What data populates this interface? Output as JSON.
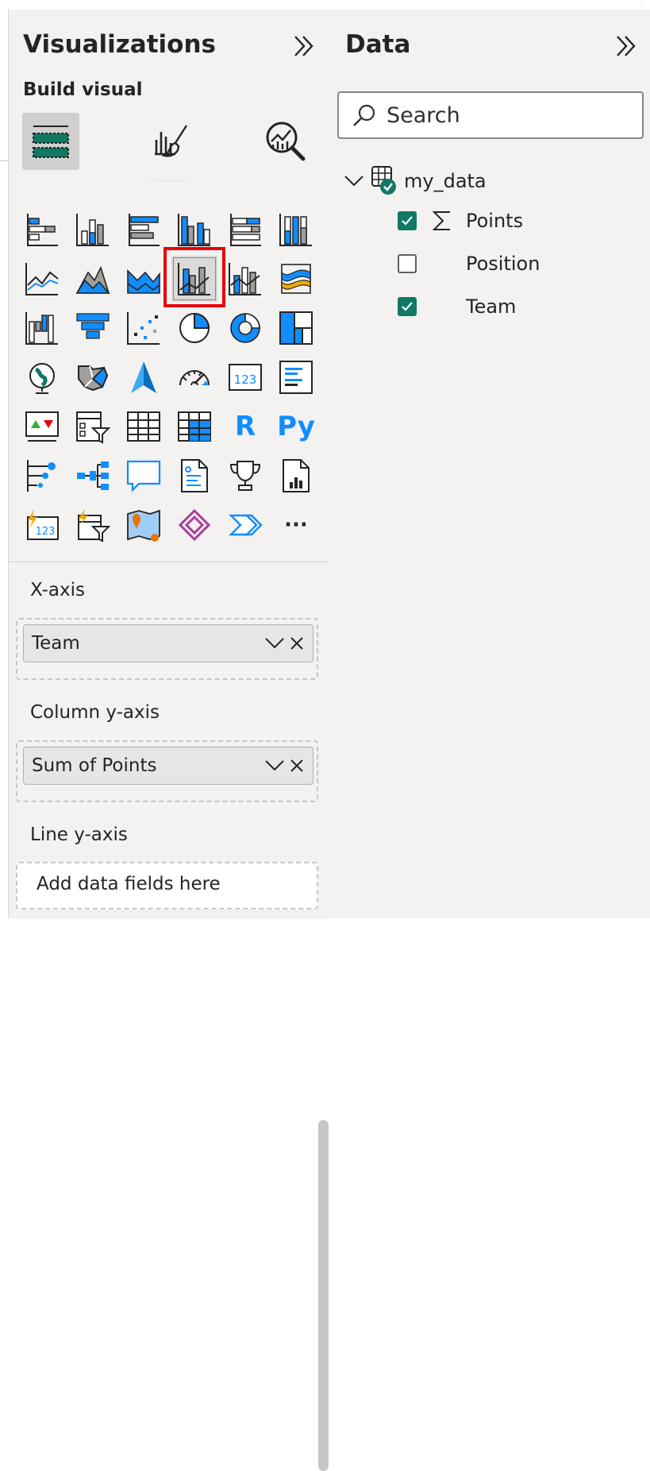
{
  "visualizations": {
    "title": "Visualizations",
    "build_visual_label": "Build visual",
    "more_label": "···",
    "r_label": "R",
    "py_label": "Py",
    "card_label": "123",
    "selected_visual": "line-and-clustered-column-chart"
  },
  "wells": {
    "x_axis": {
      "label": "X-axis",
      "field": "Team"
    },
    "column_y_axis": {
      "label": "Column y-axis",
      "field": "Sum of Points"
    },
    "line_y_axis": {
      "label": "Line y-axis",
      "placeholder": "Add data fields here"
    }
  },
  "data": {
    "title": "Data",
    "search_placeholder": "Search",
    "table": {
      "name": "my_data",
      "fields": [
        {
          "name": "Points",
          "checked": true,
          "icon": "sigma-icon"
        },
        {
          "name": "Position",
          "checked": false
        },
        {
          "name": "Team",
          "checked": true
        }
      ]
    }
  },
  "colors": {
    "accent": "#117865",
    "visual_blue": "#118dff",
    "selection": "#e8000b",
    "pane": "#f3f2f1"
  }
}
